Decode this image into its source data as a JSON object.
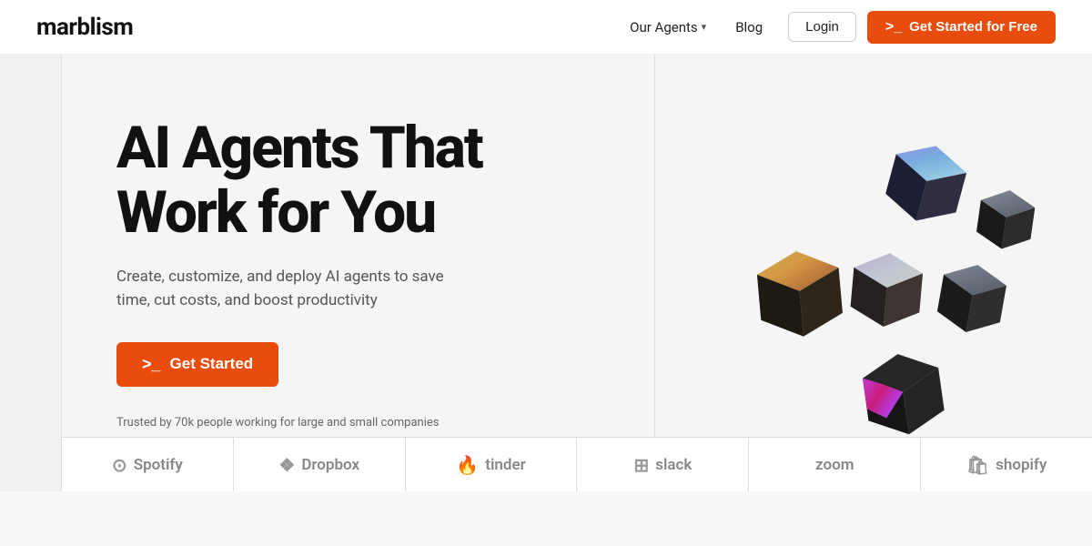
{
  "nav": {
    "logo": "marblism",
    "links": [
      {
        "label": "Our Agents",
        "has_dropdown": true
      },
      {
        "label": "Blog",
        "has_dropdown": false
      }
    ],
    "login_label": "Login",
    "cta_label": "Get Started for Free",
    "prompt_icon": ">_"
  },
  "hero": {
    "title_line1": "AI Agents That",
    "title_line2": "Work for You",
    "subtitle": "Create, customize, and deploy AI agents to save time, cut costs, and boost productivity",
    "cta_label": "Get Started",
    "prompt_icon": ">_",
    "trust_text": "Trusted by 70k people working for large and small companies"
  },
  "brands": [
    {
      "name": "Spotify",
      "icon": "spotify-icon"
    },
    {
      "name": "Dropbox",
      "icon": "dropbox-icon"
    },
    {
      "name": "tinder",
      "icon": "tinder-icon"
    },
    {
      "name": "slack",
      "icon": "slack-icon"
    },
    {
      "name": "zoom",
      "icon": "zoom-icon"
    },
    {
      "name": "shopify",
      "icon": "shopify-icon"
    }
  ],
  "colors": {
    "accent": "#e84d0e",
    "brand_gray": "#888",
    "text_dark": "#111",
    "text_muted": "#555"
  }
}
